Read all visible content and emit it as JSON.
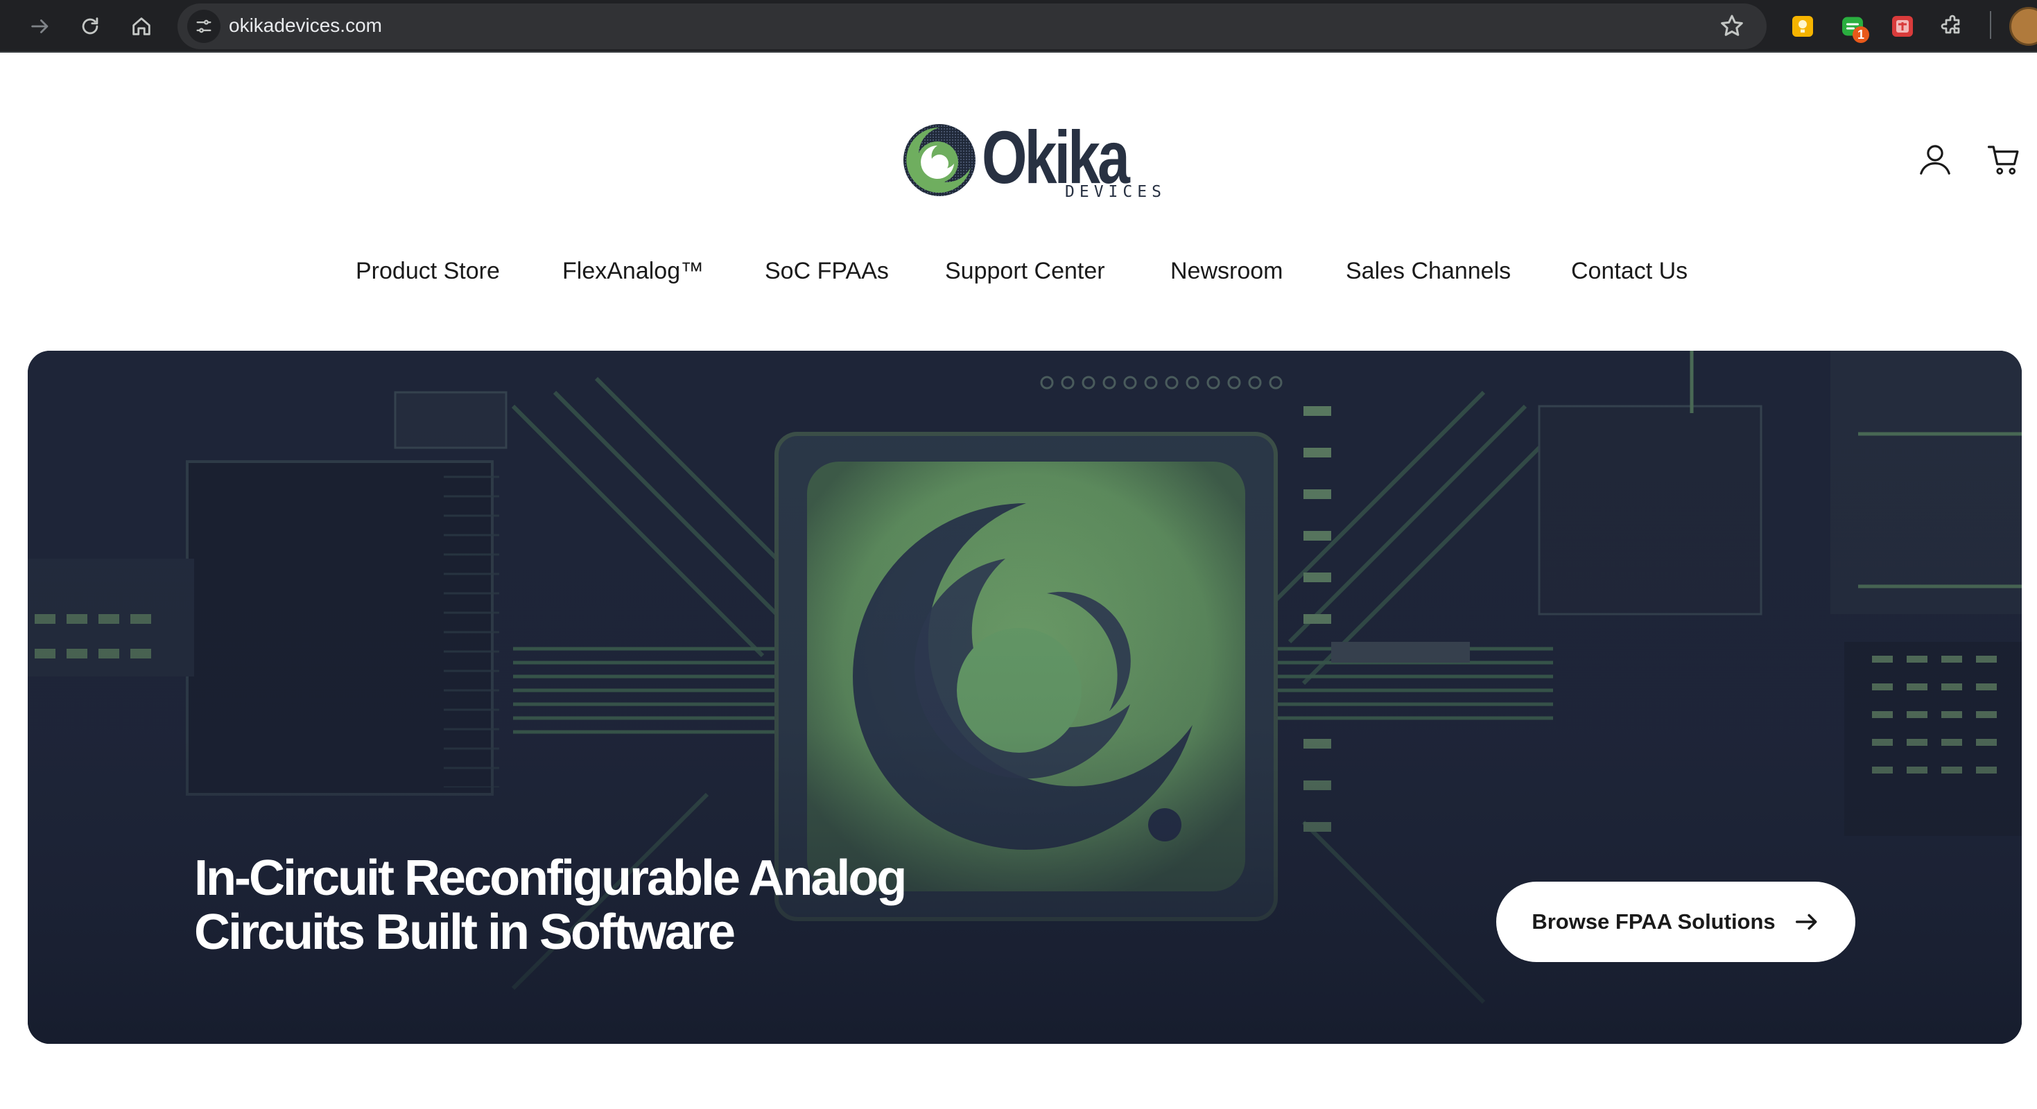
{
  "browser": {
    "url": "okikadevices.com",
    "extension_badge": "1"
  },
  "brand": {
    "name": "Okika",
    "subtitle": "DEVICES",
    "colors": {
      "primary": "#283142",
      "accent": "#6fae5f",
      "hero_bg": "#1c2235"
    }
  },
  "nav": {
    "items": [
      {
        "label": "Product Store"
      },
      {
        "label": "FlexAnalog™"
      },
      {
        "label": "SoC FPAAs"
      },
      {
        "label": "Support Center"
      },
      {
        "label": "Newsroom"
      },
      {
        "label": "Sales Channels"
      },
      {
        "label": "Contact Us"
      }
    ]
  },
  "header_icons": [
    "account-icon",
    "cart-icon"
  ],
  "hero": {
    "headline_line1": "In-Circuit Reconfigurable Analog",
    "headline_line2": "Circuits Built in Software",
    "cta_label": "Browse FPAA Solutions",
    "cta_icon": "arrow-right-icon"
  }
}
